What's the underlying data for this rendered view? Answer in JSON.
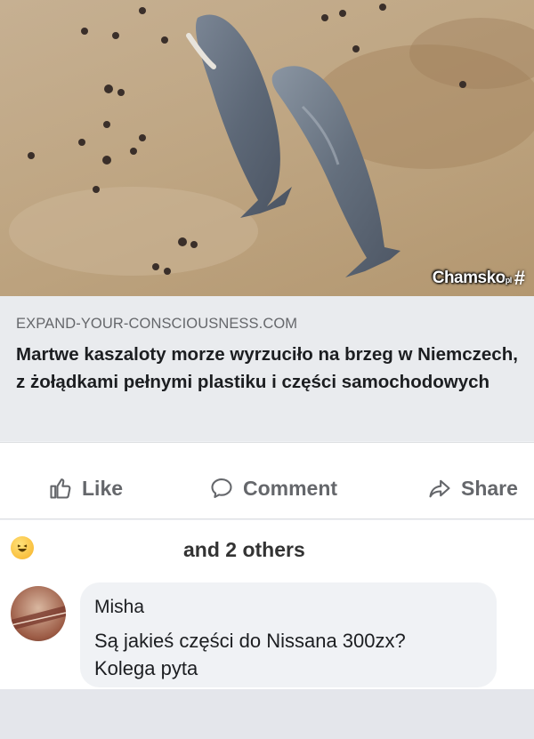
{
  "watermark": {
    "brand": "Chamsko",
    "suffix": "pl",
    "hash": "#"
  },
  "preview": {
    "domain": "EXPAND-YOUR-CONSCIOUSNESS.COM",
    "headline": "Martwe kaszaloty morze wyrzuciło na brzeg w Niemczech, z żołądkami pełnymi plastiku i części samochodowych"
  },
  "actions": {
    "like": "Like",
    "comment": "Comment",
    "share": "Share"
  },
  "reactions": {
    "summary": "and 2 others",
    "icon": "haha-emoji-icon"
  },
  "comment": {
    "author": "Misha",
    "line1": "Są jakieś części do Nissana 300zx?",
    "line2": "Kolega pyta"
  },
  "colors": {
    "secondary_text": "#65676b",
    "bubble": "#f0f2f5",
    "preview_bg": "#e9ebee"
  }
}
